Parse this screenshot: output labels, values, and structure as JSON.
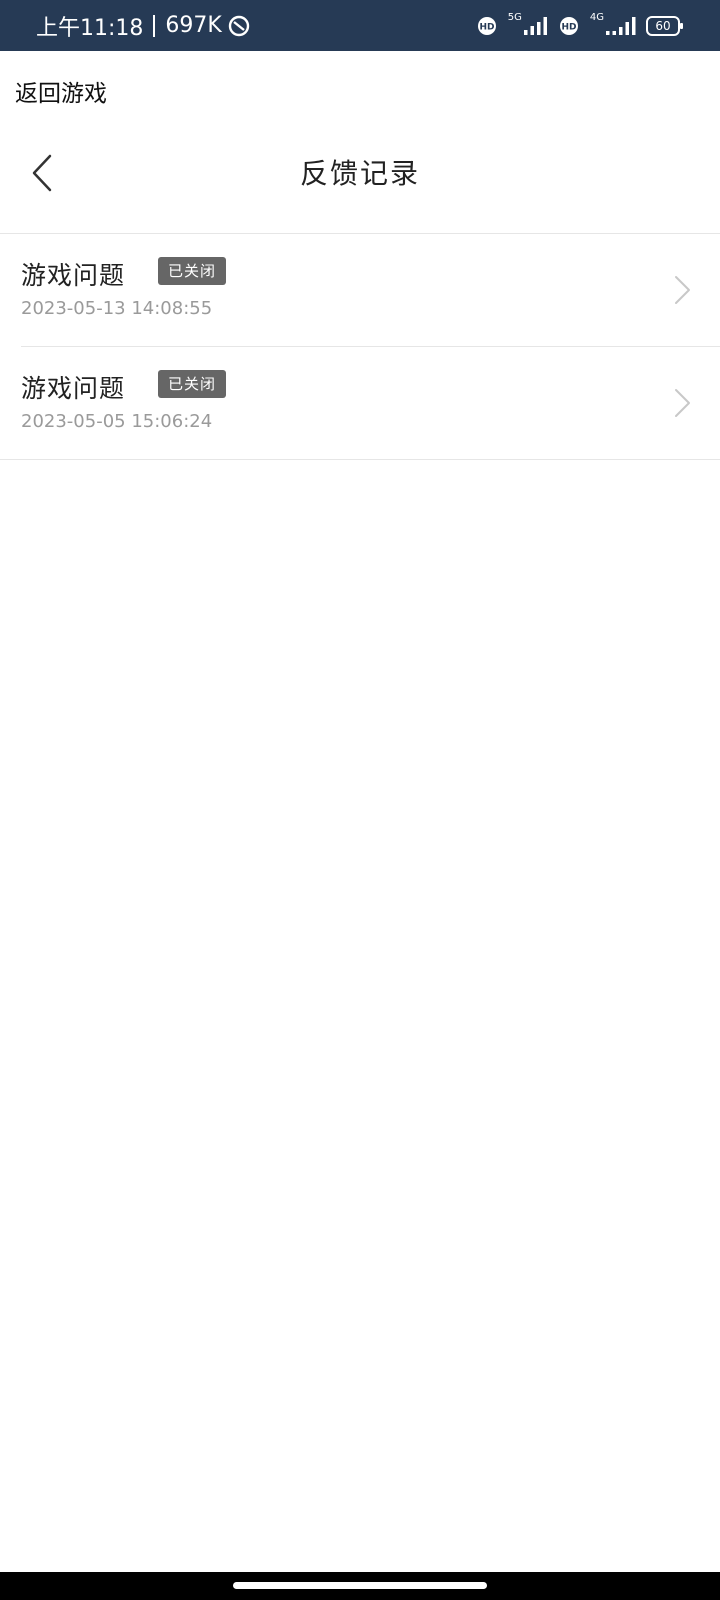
{
  "status_bar": {
    "time": "上午11:18",
    "speed": "697K",
    "hd1": "HD",
    "net1": "5G",
    "hd2": "HD",
    "net2": "4G",
    "battery": "60"
  },
  "return_game": "返回游戏",
  "nav": {
    "title": "反馈记录"
  },
  "feedback_list": [
    {
      "title": "游戏问题",
      "status": "已关闭",
      "time": "2023-05-13 14:08:55"
    },
    {
      "title": "游戏问题",
      "status": "已关闭",
      "time": "2023-05-05 15:06:24"
    }
  ],
  "colors": {
    "status_bar_bg": "#263a55",
    "badge_bg": "#666666",
    "time_text": "#9a9a9a"
  }
}
